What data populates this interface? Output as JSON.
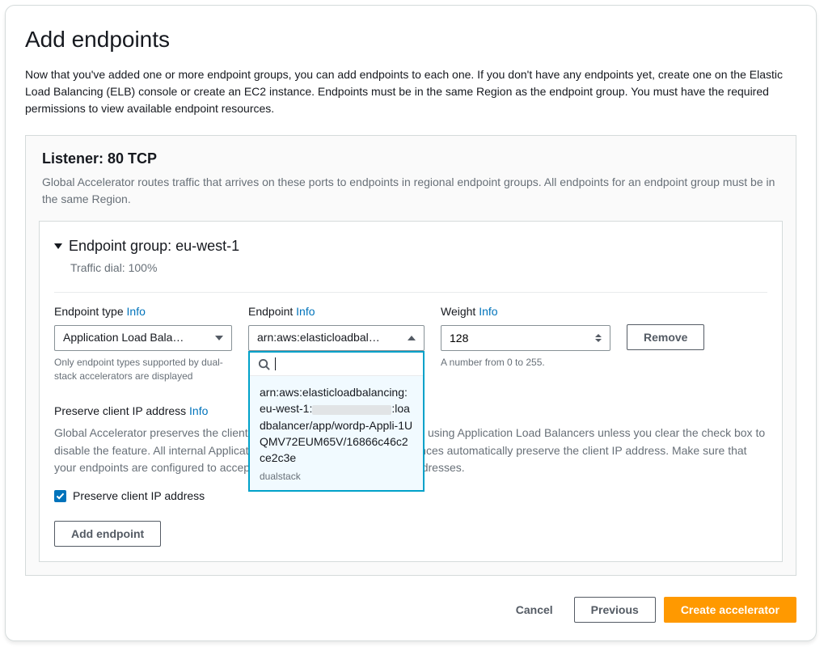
{
  "page": {
    "title": "Add endpoints",
    "intro": "Now that you've added one or more endpoint groups, you can add endpoints to each one. If you don't have any endpoints yet, create one on the Elastic Load Balancing (ELB) console or create an EC2 instance. Endpoints must be in the same Region as the endpoint group. You must have the required permissions to view available endpoint resources."
  },
  "listener": {
    "title": "Listener: 80 TCP",
    "desc": "Global Accelerator routes traffic that arrives on these ports to endpoints in regional endpoint groups. All endpoints for an endpoint group must be in the same Region."
  },
  "endpoint_group": {
    "title": "Endpoint group: eu-west-1",
    "subtitle": "Traffic dial: 100%"
  },
  "fields": {
    "type_label": "Endpoint type ",
    "endpoint_label": "Endpoint ",
    "weight_label": "Weight ",
    "info": "Info",
    "type_value": "Application Load Bala…",
    "type_hint": "Only endpoint types supported by dual-stack accelerators are displayed",
    "endpoint_value": "arn:aws:elasticloadbal…",
    "weight_value": "128",
    "weight_hint": "A number from 0 to 255.",
    "remove_label": "Remove"
  },
  "dropdown": {
    "option_prefix": "arn:aws:elasticloadbalancing:eu-west-1:",
    "option_suffix": ":loadbalancer/app/wordp-Appli-1UQMV72EUM65V/16866c46c2ce2c3e",
    "sublabel": "dualstack"
  },
  "preserve": {
    "title": "Preserve client IP address ",
    "desc": "Global Accelerator preserves the client IP address for all new accelerators using Application Load Balancers unless you clear the check box to disable the feature. All internal Application Load Balancers and EC2 instances automatically preserve the client IP address. Make sure that your endpoints are configured to accept traffic from preserved client IP addresses.",
    "checkbox_label": "Preserve client IP address"
  },
  "buttons": {
    "add_endpoint": "Add endpoint",
    "cancel": "Cancel",
    "previous": "Previous",
    "create": "Create accelerator"
  }
}
